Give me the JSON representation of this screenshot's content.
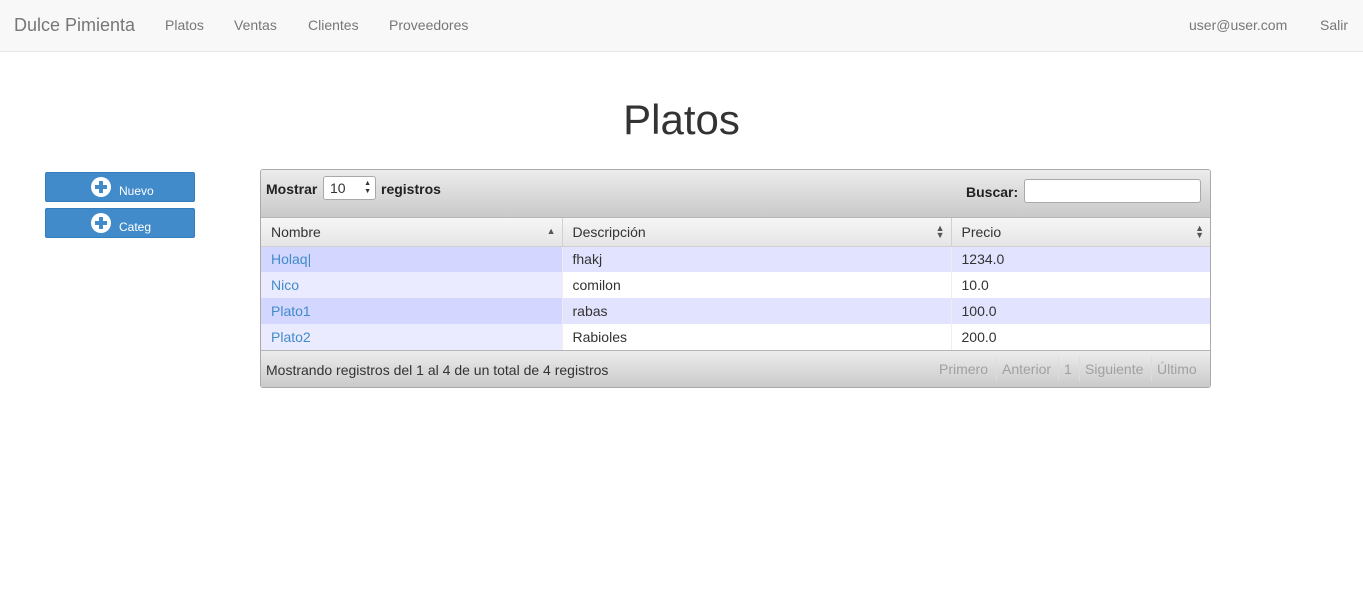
{
  "navbar": {
    "brand": "Dulce Pimienta",
    "links": [
      "Platos",
      "Ventas",
      "Clientes",
      "Proveedores"
    ],
    "user": "user@user.com",
    "logout": "Salir"
  },
  "page": {
    "title": "Platos"
  },
  "actions": {
    "new_label": "Nuevo",
    "category_label": "Categ",
    "icon": "plus-circle-icon"
  },
  "table_controls": {
    "show_label": "Mostrar",
    "length_value": "10",
    "records_label": "registros",
    "search_label": "Buscar:",
    "search_value": ""
  },
  "table": {
    "columns": [
      "Nombre",
      "Descripción",
      "Precio"
    ],
    "sorted_column": "Nombre",
    "sort_direction": "asc",
    "rows": [
      {
        "nombre": "Holaq|",
        "descripcion": "fhakj",
        "precio": "1234.0"
      },
      {
        "nombre": "Nico",
        "descripcion": "comilon",
        "precio": "10.0"
      },
      {
        "nombre": "Plato1",
        "descripcion": "rabas",
        "precio": "100.0"
      },
      {
        "nombre": "Plato2",
        "descripcion": "Rabioles",
        "precio": "200.0"
      }
    ]
  },
  "footer": {
    "info": "Mostrando registros del 1 al 4 de un total de 4 registros",
    "pagination": {
      "first": "Primero",
      "previous": "Anterior",
      "current": "1",
      "next": "Siguiente",
      "last": "Último"
    }
  },
  "colors": {
    "primary": "#428bca",
    "row_odd": "#e2e4ff",
    "row_even": "#ffffff",
    "nav_text": "#777777"
  }
}
